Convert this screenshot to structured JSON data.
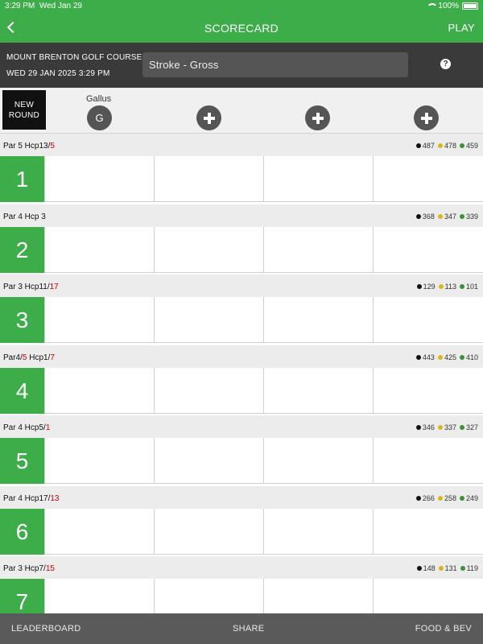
{
  "status_bar": {
    "time": "3:29 PM",
    "date": "Wed Jan 29",
    "battery": "100%"
  },
  "header": {
    "title": "SCORECARD",
    "play_label": "PLAY"
  },
  "round_info": {
    "course": "MOUNT BRENTON GOLF COURSE",
    "datetime": "WED 29 JAN 2025 3:29 PM",
    "mode": "Stroke - Gross",
    "help": "?"
  },
  "players": {
    "new_round_line1": "NEW",
    "new_round_line2": "ROUND",
    "player1": {
      "name": "Gallus",
      "initial": "G"
    }
  },
  "tee_colors": {
    "black": "#111111",
    "yellow": "#d8b620",
    "green": "#3e8f3e"
  },
  "holes": [
    {
      "number": "1",
      "par_text": "Par 5 Hcp13/",
      "hcp_alt": "5",
      "black": "487",
      "yellow": "478",
      "green": "459"
    },
    {
      "number": "2",
      "par_text": "Par 4 Hcp 3",
      "hcp_alt": "",
      "black": "368",
      "yellow": "347",
      "green": "339"
    },
    {
      "number": "3",
      "par_text": "Par 3 Hcp11/",
      "hcp_alt": "17",
      "black": "129",
      "yellow": "113",
      "green": "101"
    },
    {
      "number": "4",
      "par_text": "Par4/",
      "par_alt": "5",
      "par_text2": " Hcp1/",
      "hcp_alt": "7",
      "black": "443",
      "yellow": "425",
      "green": "410"
    },
    {
      "number": "5",
      "par_text": "Par 4 Hcp5/",
      "hcp_alt": "1",
      "black": "346",
      "yellow": "337",
      "green": "327"
    },
    {
      "number": "6",
      "par_text": "Par 4 Hcp17/",
      "hcp_alt": "13",
      "black": "266",
      "yellow": "258",
      "green": "249"
    },
    {
      "number": "7",
      "par_text": "Par 3 Hcp7/",
      "hcp_alt": "15",
      "black": "148",
      "yellow": "131",
      "green": "119"
    }
  ],
  "bottom_nav": {
    "leaderboard": "LEADERBOARD",
    "share": "SHARE",
    "food": "FOOD & BEV"
  }
}
